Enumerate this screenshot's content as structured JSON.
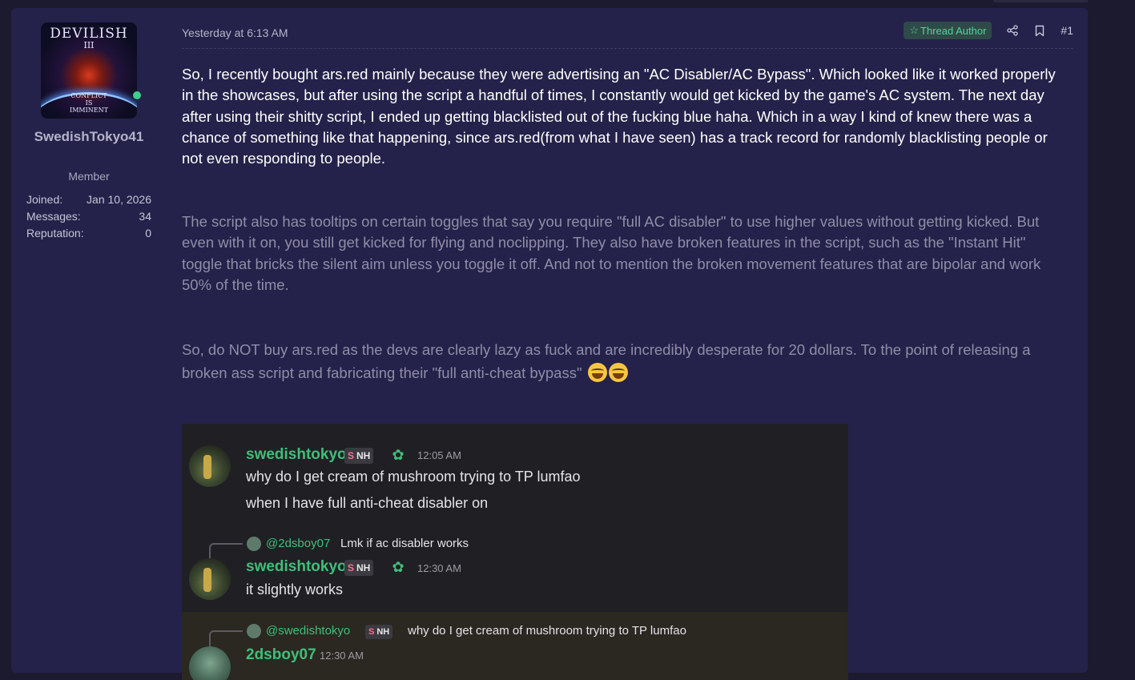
{
  "user": {
    "avatar_title": "DEVILISH",
    "avatar_sub": "III",
    "avatar_footer": [
      "CONFLICT",
      "IS",
      "IMMINENT"
    ],
    "username": "SwedishTokyo41",
    "role": "Member",
    "stats": [
      {
        "label": "Joined:",
        "value": "Jan 10, 2026"
      },
      {
        "label": "Messages:",
        "value": "34"
      },
      {
        "label": "Reputation:",
        "value": "0"
      }
    ]
  },
  "message": {
    "time": "Yesterday at 6:13 AM",
    "badge": "Thread Author",
    "post_number": "#1",
    "paragraphs": [
      "So, I recently bought ars.red mainly because they were advertising an \"AC Disabler/AC Bypass\". Which looked like it worked properly in the showcases, but after using the script a handful of times, I constantly would get kicked by the game's AC system. The next day after using their shitty script, I ended up getting blacklisted out of the fucking blue haha. Which in a way I kind of knew there was a chance of something like that happening, since ars.red(from what I have seen) has a track record for randomly blacklisting people or not even responding to people.",
      "The script also has tooltips on certain toggles that say you require \"full AC disabler\" to use higher values without getting kicked. But even with it on, you still get kicked for flying and noclipping. They also have broken features in the script, such as the \"Instant Hit\" toggle that bricks the silent aim unless you toggle it off. And not to mention the broken movement features that are bipolar and work 50% of the time.",
      "So, do NOT buy ars.red as the devs are clearly lazy as fuck and are incredibly desperate for 20 dollars. To the point of releasing a broken ass script and fabricating their \"full anti-cheat bypass\""
    ],
    "emojis": [
      "joy-emoji",
      "joy-emoji"
    ]
  },
  "screenshot": {
    "messages": [
      {
        "name": "swedishtokyo",
        "tag": "NH",
        "time": "12:05 AM",
        "lines": [
          "why do I get cream of mushroom trying to TP lumfao",
          "when I have full anti-cheat disabler on"
        ]
      },
      {
        "reply_to": "@2dsboy07",
        "reply_text": "Lmk if ac disabler works",
        "name": "swedishtokyo",
        "tag": "NH",
        "time": "12:30 AM",
        "lines": [
          "it slightly works"
        ]
      },
      {
        "reply_to": "@swedishtokyo",
        "reply_tag": "NH",
        "reply_text": "why do I get cream of mushroom trying to TP lumfao",
        "name": "2dsboy07",
        "time": "12:30 AM"
      }
    ]
  },
  "colors": {
    "background": "#1b1a2e",
    "post_bg": "#24224a",
    "accent_green": "#55d49a",
    "discord_name": "#3fbf7a"
  }
}
